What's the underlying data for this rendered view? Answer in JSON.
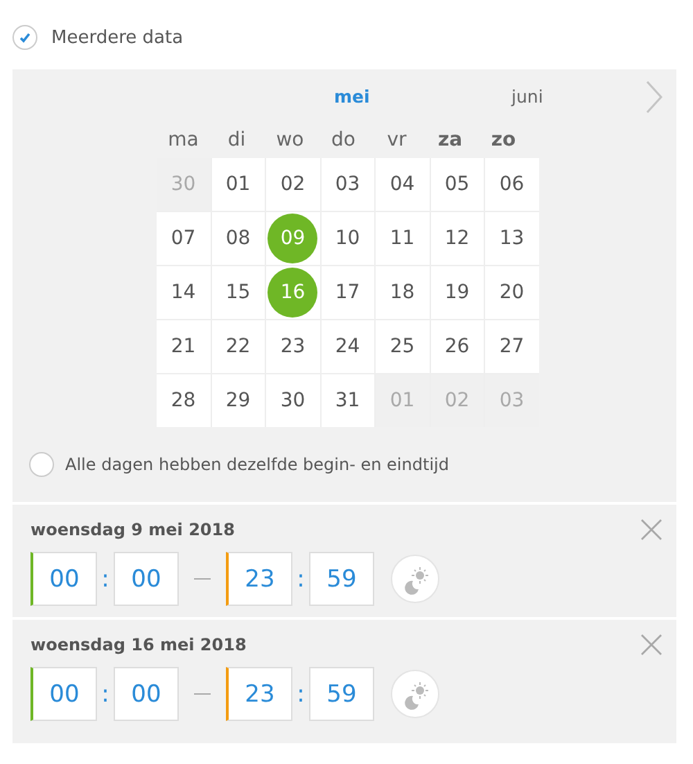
{
  "multiple_dates": {
    "label": "Meerdere data",
    "checked": true
  },
  "calendar": {
    "months": [
      {
        "label": "mei",
        "selected": true
      },
      {
        "label": "juni",
        "selected": false
      }
    ],
    "weekdays": [
      {
        "label": "ma",
        "weekend": false
      },
      {
        "label": "di",
        "weekend": false
      },
      {
        "label": "wo",
        "weekend": false
      },
      {
        "label": "do",
        "weekend": false
      },
      {
        "label": "vr",
        "weekend": false
      },
      {
        "label": "za",
        "weekend": true
      },
      {
        "label": "zo",
        "weekend": true
      }
    ],
    "days": [
      {
        "label": "30",
        "outside": true,
        "selected": false
      },
      {
        "label": "01",
        "outside": false,
        "selected": false
      },
      {
        "label": "02",
        "outside": false,
        "selected": false
      },
      {
        "label": "03",
        "outside": false,
        "selected": false
      },
      {
        "label": "04",
        "outside": false,
        "selected": false
      },
      {
        "label": "05",
        "outside": false,
        "selected": false
      },
      {
        "label": "06",
        "outside": false,
        "selected": false
      },
      {
        "label": "07",
        "outside": false,
        "selected": false
      },
      {
        "label": "08",
        "outside": false,
        "selected": false
      },
      {
        "label": "09",
        "outside": false,
        "selected": true
      },
      {
        "label": "10",
        "outside": false,
        "selected": false
      },
      {
        "label": "11",
        "outside": false,
        "selected": false
      },
      {
        "label": "12",
        "outside": false,
        "selected": false
      },
      {
        "label": "13",
        "outside": false,
        "selected": false
      },
      {
        "label": "14",
        "outside": false,
        "selected": false
      },
      {
        "label": "15",
        "outside": false,
        "selected": false
      },
      {
        "label": "16",
        "outside": false,
        "selected": true
      },
      {
        "label": "17",
        "outside": false,
        "selected": false
      },
      {
        "label": "18",
        "outside": false,
        "selected": false
      },
      {
        "label": "19",
        "outside": false,
        "selected": false
      },
      {
        "label": "20",
        "outside": false,
        "selected": false
      },
      {
        "label": "21",
        "outside": false,
        "selected": false
      },
      {
        "label": "22",
        "outside": false,
        "selected": false
      },
      {
        "label": "23",
        "outside": false,
        "selected": false
      },
      {
        "label": "24",
        "outside": false,
        "selected": false
      },
      {
        "label": "25",
        "outside": false,
        "selected": false
      },
      {
        "label": "26",
        "outside": false,
        "selected": false
      },
      {
        "label": "27",
        "outside": false,
        "selected": false
      },
      {
        "label": "28",
        "outside": false,
        "selected": false
      },
      {
        "label": "29",
        "outside": false,
        "selected": false
      },
      {
        "label": "30",
        "outside": false,
        "selected": false
      },
      {
        "label": "31",
        "outside": false,
        "selected": false
      },
      {
        "label": "01",
        "outside": true,
        "selected": false
      },
      {
        "label": "02",
        "outside": true,
        "selected": false
      },
      {
        "label": "03",
        "outside": true,
        "selected": false
      }
    ]
  },
  "same_times": {
    "label": "Alle dagen hebben dezelfde begin- en eindtijd",
    "checked": false
  },
  "dates": [
    {
      "title": "woensdag 9 mei 2018",
      "start_hour": "00",
      "start_separator": ":",
      "start_minute": "00",
      "end_hour": "23",
      "end_separator": ":",
      "end_minute": "59"
    },
    {
      "title": "woensdag 16 mei 2018",
      "start_hour": "00",
      "start_separator": ":",
      "start_minute": "00",
      "end_hour": "23",
      "end_separator": ":",
      "end_minute": "59"
    }
  ]
}
